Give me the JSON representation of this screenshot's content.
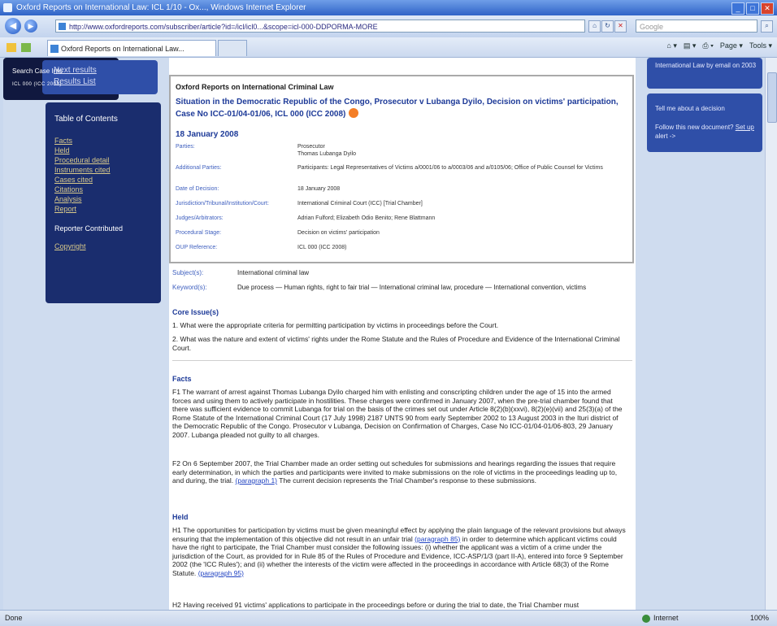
{
  "window": {
    "title": "Oxford Reports on International Law: ICL 1/10 - Ox..., Windows Internet Explorer"
  },
  "address_bar": {
    "url": "http://www.oxfordreports.com/subscriber/article?id=/icl/icl0...&scope=icl-000-DDPORMA-MORE",
    "search_placeholder": "Google"
  },
  "tabs": [
    {
      "label": "Oxford Reports on International Law..."
    }
  ],
  "command_bar": {
    "page": "Page",
    "tools": "Tools"
  },
  "left_nav": {
    "links": [
      "Next results",
      "Results List"
    ]
  },
  "toc": {
    "heading": "Table of Contents",
    "items": [
      "Facts",
      "Held",
      "Procedural detail",
      "Instruments cited",
      "Cases cited",
      "Citations",
      "Analysis",
      "Report",
      "Reporter Contributed",
      "Copyright"
    ]
  },
  "report": {
    "series": "Oxford Reports on International Criminal Law",
    "case_title": "Situation in the Democratic Republic of the Congo, Prosecutor v Lubanga Dyilo, Decision on victims' participation, Case No ICC-01/04-01/06, ICL 000 (ICC 2008)",
    "date": "18 January 2008",
    "meta": [
      {
        "k": "Parties:",
        "v": "Prosecutor\nThomas Lubanga Dyilo"
      },
      {
        "k": "Additional Parties:",
        "v": "Participants: Legal Representatives of Victims a/0001/06 to a/0003/06 and a/0105/06; Office of Public Counsel for Victims"
      },
      {
        "k": "Date of Decision:",
        "v": "18 January 2008"
      },
      {
        "k": "Jurisdiction/Tribunal/Institution/Court:",
        "v": "International Criminal Court (ICC) [Trial Chamber]"
      },
      {
        "k": "Judges/Arbitrators:",
        "v": "Adrian Fulford; Elizabeth Odio Benito; Rene Blattmann"
      },
      {
        "k": "Procedural Stage:",
        "v": "Decision on victims' participation"
      },
      {
        "k": "OUP Reference:",
        "v": "ICL 000 (ICC 2008)"
      }
    ]
  },
  "subjects": [
    {
      "k": "Subject(s):",
      "v": "International criminal law"
    },
    {
      "k": "Keyword(s):",
      "v": "Due process — Human rights, right to fair trial — International criminal law, procedure — International convention, victims"
    }
  ],
  "core_issues": {
    "heading": "Core Issue(s)",
    "items": [
      "1. What were the appropriate criteria for permitting participation by victims in proceedings before the Court.",
      "2. What was the nature and extent of victims' rights under the Rome Statute and the Rules of Procedure and Evidence of the International Criminal Court."
    ]
  },
  "facts": {
    "heading": "Facts",
    "paragraphs": [
      "F1 The warrant of arrest against Thomas Lubanga Dyilo charged him with enlisting and conscripting children under the age of 15 into the armed forces and using them to actively participate in hostilities. These charges were confirmed in January 2007, when the pre-trial chamber found that there was sufficient evidence to commit Lubanga for trial on the basis of the crimes set out under Article 8(2)(b)(xxvi), 8(2)(e)(vii) and 25(3)(a) of the Rome Statute of the International Criminal Court (17 July 1998) 2187 UNTS 90 from early September 2002 to 13 August 2003 in the Ituri district of the Democratic Republic of the Congo. Prosecutor v Lubanga, Decision on Confirmation of Charges, Case No ICC-01/04-01/06-803, 29 January 2007. Lubanga pleaded not guilty to all charges.",
      "F2 On 6 September 2007, the Trial Chamber made an order setting out schedules for submissions and hearings regarding the issues that require early determination, in which the parties and participants were invited to make submissions on the role of victims in the proceedings leading up to, and during, the trial.",
      "The current decision represents the Trial Chamber's response to these submissions."
    ],
    "link": "(paragraph 1)"
  },
  "held": {
    "heading": "Held",
    "paragraphs": [
      "H1 The opportunities for participation by victims must be given meaningful effect by applying the plain language of the relevant provisions but always ensuring that the implementation of this objective did not result in an unfair trial",
      "in order to determine which applicant victims could have the right to participate, the Trial Chamber must consider the following issues: (i) whether the applicant was a victim of a crime under the jurisdiction of the Court, as provided for in Rule 85 of the Rules of Procedure and Evidence, ICC-ASP/1/3 (part II-A), entered into force 9 September 2002 (the 'ICC Rules'); and (ii) whether the interests of the victim were affected in the proceedings in accordance with Article 68(3) of the Rome Statute.",
      "H2 Having received 91 victims' applications to participate in the proceedings before or during the trial to date, the Trial Chamber must"
    ],
    "link1": "(paragraph 85)",
    "link2": "(paragraph 95)"
  },
  "right_boxes": {
    "box1": "International Law by email on 2003",
    "alert_title": "Tell me about a decision",
    "alert_text": "Follow this new document?",
    "alert_link": "Set up",
    "alert_suffix": "alert ->",
    "search_title": "Search Case Info",
    "search_sub": "ICL 000 (ICC 2008)"
  },
  "status_bar": {
    "left": "Done",
    "zone": "Internet",
    "zoom": "100%"
  }
}
